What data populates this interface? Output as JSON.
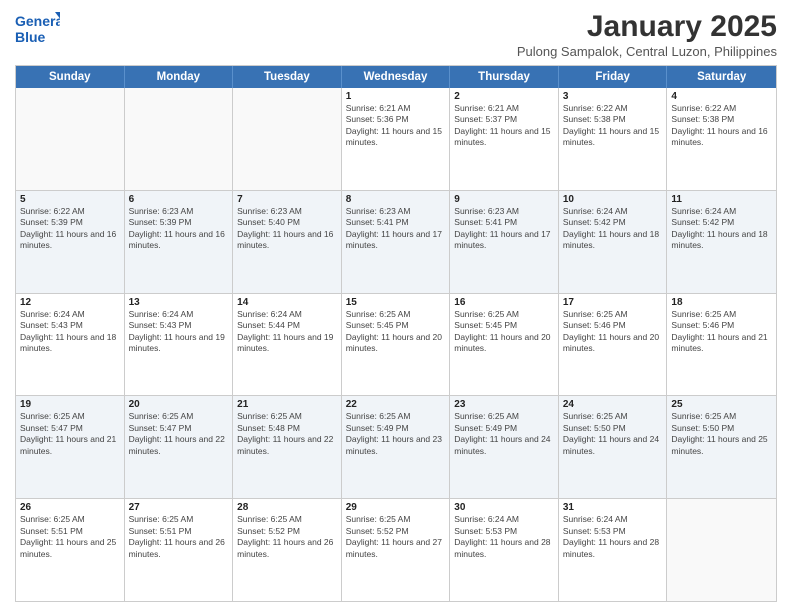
{
  "logo": {
    "line1": "General",
    "line2": "Blue"
  },
  "title": "January 2025",
  "subtitle": "Pulong Sampalok, Central Luzon, Philippines",
  "header_days": [
    "Sunday",
    "Monday",
    "Tuesday",
    "Wednesday",
    "Thursday",
    "Friday",
    "Saturday"
  ],
  "weeks": [
    [
      {
        "day": "",
        "sunrise": "",
        "sunset": "",
        "daylight": "",
        "empty": true
      },
      {
        "day": "",
        "sunrise": "",
        "sunset": "",
        "daylight": "",
        "empty": true
      },
      {
        "day": "",
        "sunrise": "",
        "sunset": "",
        "daylight": "",
        "empty": true
      },
      {
        "day": "1",
        "sunrise": "Sunrise: 6:21 AM",
        "sunset": "Sunset: 5:36 PM",
        "daylight": "Daylight: 11 hours and 15 minutes."
      },
      {
        "day": "2",
        "sunrise": "Sunrise: 6:21 AM",
        "sunset": "Sunset: 5:37 PM",
        "daylight": "Daylight: 11 hours and 15 minutes."
      },
      {
        "day": "3",
        "sunrise": "Sunrise: 6:22 AM",
        "sunset": "Sunset: 5:38 PM",
        "daylight": "Daylight: 11 hours and 15 minutes."
      },
      {
        "day": "4",
        "sunrise": "Sunrise: 6:22 AM",
        "sunset": "Sunset: 5:38 PM",
        "daylight": "Daylight: 11 hours and 16 minutes."
      }
    ],
    [
      {
        "day": "5",
        "sunrise": "Sunrise: 6:22 AM",
        "sunset": "Sunset: 5:39 PM",
        "daylight": "Daylight: 11 hours and 16 minutes."
      },
      {
        "day": "6",
        "sunrise": "Sunrise: 6:23 AM",
        "sunset": "Sunset: 5:39 PM",
        "daylight": "Daylight: 11 hours and 16 minutes."
      },
      {
        "day": "7",
        "sunrise": "Sunrise: 6:23 AM",
        "sunset": "Sunset: 5:40 PM",
        "daylight": "Daylight: 11 hours and 16 minutes."
      },
      {
        "day": "8",
        "sunrise": "Sunrise: 6:23 AM",
        "sunset": "Sunset: 5:41 PM",
        "daylight": "Daylight: 11 hours and 17 minutes."
      },
      {
        "day": "9",
        "sunrise": "Sunrise: 6:23 AM",
        "sunset": "Sunset: 5:41 PM",
        "daylight": "Daylight: 11 hours and 17 minutes."
      },
      {
        "day": "10",
        "sunrise": "Sunrise: 6:24 AM",
        "sunset": "Sunset: 5:42 PM",
        "daylight": "Daylight: 11 hours and 18 minutes."
      },
      {
        "day": "11",
        "sunrise": "Sunrise: 6:24 AM",
        "sunset": "Sunset: 5:42 PM",
        "daylight": "Daylight: 11 hours and 18 minutes."
      }
    ],
    [
      {
        "day": "12",
        "sunrise": "Sunrise: 6:24 AM",
        "sunset": "Sunset: 5:43 PM",
        "daylight": "Daylight: 11 hours and 18 minutes."
      },
      {
        "day": "13",
        "sunrise": "Sunrise: 6:24 AM",
        "sunset": "Sunset: 5:43 PM",
        "daylight": "Daylight: 11 hours and 19 minutes."
      },
      {
        "day": "14",
        "sunrise": "Sunrise: 6:24 AM",
        "sunset": "Sunset: 5:44 PM",
        "daylight": "Daylight: 11 hours and 19 minutes."
      },
      {
        "day": "15",
        "sunrise": "Sunrise: 6:25 AM",
        "sunset": "Sunset: 5:45 PM",
        "daylight": "Daylight: 11 hours and 20 minutes."
      },
      {
        "day": "16",
        "sunrise": "Sunrise: 6:25 AM",
        "sunset": "Sunset: 5:45 PM",
        "daylight": "Daylight: 11 hours and 20 minutes."
      },
      {
        "day": "17",
        "sunrise": "Sunrise: 6:25 AM",
        "sunset": "Sunset: 5:46 PM",
        "daylight": "Daylight: 11 hours and 20 minutes."
      },
      {
        "day": "18",
        "sunrise": "Sunrise: 6:25 AM",
        "sunset": "Sunset: 5:46 PM",
        "daylight": "Daylight: 11 hours and 21 minutes."
      }
    ],
    [
      {
        "day": "19",
        "sunrise": "Sunrise: 6:25 AM",
        "sunset": "Sunset: 5:47 PM",
        "daylight": "Daylight: 11 hours and 21 minutes."
      },
      {
        "day": "20",
        "sunrise": "Sunrise: 6:25 AM",
        "sunset": "Sunset: 5:47 PM",
        "daylight": "Daylight: 11 hours and 22 minutes."
      },
      {
        "day": "21",
        "sunrise": "Sunrise: 6:25 AM",
        "sunset": "Sunset: 5:48 PM",
        "daylight": "Daylight: 11 hours and 22 minutes."
      },
      {
        "day": "22",
        "sunrise": "Sunrise: 6:25 AM",
        "sunset": "Sunset: 5:49 PM",
        "daylight": "Daylight: 11 hours and 23 minutes."
      },
      {
        "day": "23",
        "sunrise": "Sunrise: 6:25 AM",
        "sunset": "Sunset: 5:49 PM",
        "daylight": "Daylight: 11 hours and 24 minutes."
      },
      {
        "day": "24",
        "sunrise": "Sunrise: 6:25 AM",
        "sunset": "Sunset: 5:50 PM",
        "daylight": "Daylight: 11 hours and 24 minutes."
      },
      {
        "day": "25",
        "sunrise": "Sunrise: 6:25 AM",
        "sunset": "Sunset: 5:50 PM",
        "daylight": "Daylight: 11 hours and 25 minutes."
      }
    ],
    [
      {
        "day": "26",
        "sunrise": "Sunrise: 6:25 AM",
        "sunset": "Sunset: 5:51 PM",
        "daylight": "Daylight: 11 hours and 25 minutes."
      },
      {
        "day": "27",
        "sunrise": "Sunrise: 6:25 AM",
        "sunset": "Sunset: 5:51 PM",
        "daylight": "Daylight: 11 hours and 26 minutes."
      },
      {
        "day": "28",
        "sunrise": "Sunrise: 6:25 AM",
        "sunset": "Sunset: 5:52 PM",
        "daylight": "Daylight: 11 hours and 26 minutes."
      },
      {
        "day": "29",
        "sunrise": "Sunrise: 6:25 AM",
        "sunset": "Sunset: 5:52 PM",
        "daylight": "Daylight: 11 hours and 27 minutes."
      },
      {
        "day": "30",
        "sunrise": "Sunrise: 6:24 AM",
        "sunset": "Sunset: 5:53 PM",
        "daylight": "Daylight: 11 hours and 28 minutes."
      },
      {
        "day": "31",
        "sunrise": "Sunrise: 6:24 AM",
        "sunset": "Sunset: 5:53 PM",
        "daylight": "Daylight: 11 hours and 28 minutes."
      },
      {
        "day": "",
        "sunrise": "",
        "sunset": "",
        "daylight": "",
        "empty": true
      }
    ]
  ]
}
